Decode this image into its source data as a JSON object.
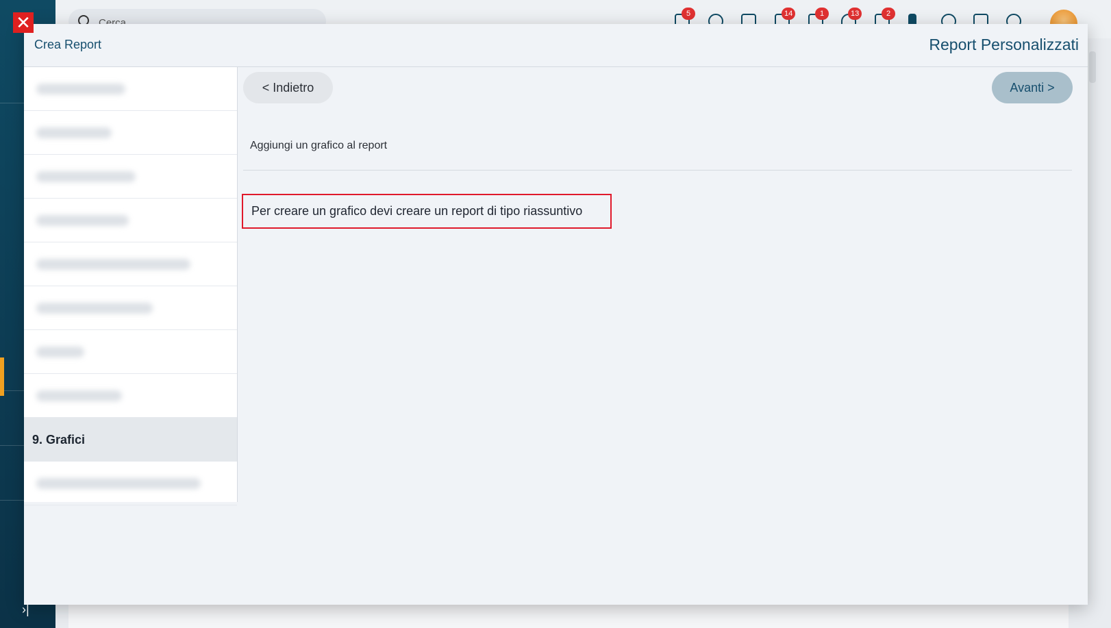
{
  "app": {
    "search_placeholder": "Cerca",
    "badges": [
      "5",
      "14",
      "1",
      "13",
      "2"
    ],
    "accent_color": "#f0a020",
    "sidebar_color": "#0f4a63"
  },
  "modal": {
    "title": "Crea Report",
    "module": "Report Personalizzati",
    "close_label": "✕",
    "steps_active_label": "9. Grafici",
    "back_label": "< Indietro",
    "next_label": "Avanti >",
    "section_title": "Aggiungi un grafico al report",
    "notice": "Per creare un grafico devi creare un report di tipo riassuntivo",
    "notice_border_color": "#e0192b"
  }
}
